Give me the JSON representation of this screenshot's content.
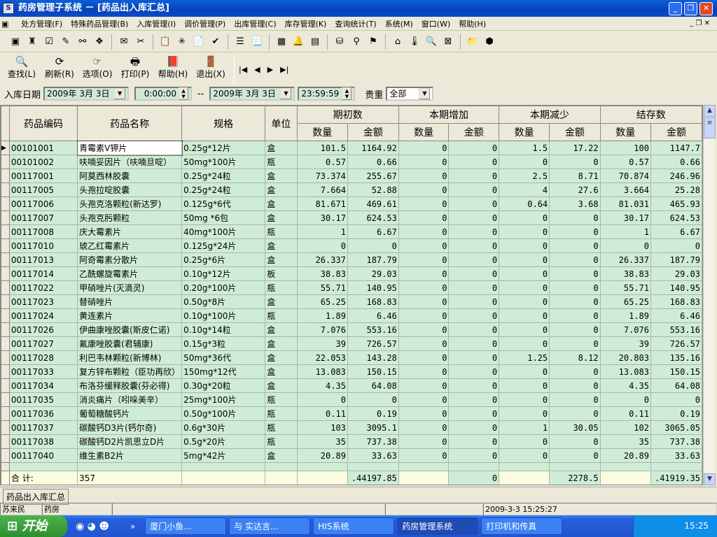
{
  "window": {
    "title": "药房管理子系统 － [药品出入库汇总]"
  },
  "menu": [
    "处方管理(F)",
    "特殊药品管理(B)",
    "入库管理(I)",
    "调价管理(P)",
    "出库管理(C)",
    "库存管理(K)",
    "查询统计(T)",
    "系统(M)",
    "窗口(W)",
    "帮助(H)"
  ],
  "toolbar2": [
    {
      "icon": "search-icon",
      "glyph": "🔍",
      "label": "查找(L)"
    },
    {
      "icon": "refresh-icon",
      "glyph": "⟳",
      "label": "刷新(R)"
    },
    {
      "icon": "options-icon",
      "glyph": "☞",
      "label": "选项(O)"
    },
    {
      "icon": "printer-icon",
      "glyph": "🖶",
      "label": "打印(P)"
    },
    {
      "icon": "help-book-icon",
      "glyph": "📕",
      "label": "帮助(H)"
    },
    {
      "icon": "exit-door-icon",
      "glyph": "🚪",
      "label": "退出(X)"
    }
  ],
  "nav": [
    "|◀",
    "◀",
    "▶",
    "▶|"
  ],
  "filters": {
    "label": "入库日期",
    "date_from": "2009年  3月  3日",
    "time_from": "0:00:00",
    "dash": "--",
    "date_to": "2009年  3月  3日",
    "time_to": "23:59:59",
    "price_label": "贵重",
    "price_value": "全部"
  },
  "grid": {
    "headers": {
      "code": "药品编码",
      "name": "药品名称",
      "spec": "规格",
      "unit": "单位",
      "groups": [
        "期初数",
        "本期增加",
        "本期减少",
        "结存数"
      ],
      "qty": "数量",
      "amt": "金额"
    },
    "rows": [
      [
        "00101001",
        "青霉素V钾片",
        "0.25g*12片",
        "盒",
        "101.5",
        "1164.92",
        "0",
        "0",
        "1.5",
        "17.22",
        "100",
        "1147.7"
      ],
      [
        "00101002",
        "呋喃妥因片（呋喃旦啶）",
        "50mg*100片",
        "瓶",
        "0.57",
        "0.66",
        "0",
        "0",
        "0",
        "0",
        "0.57",
        "0.66"
      ],
      [
        "00117001",
        "阿莫西林胶囊",
        "0.25g*24粒",
        "盒",
        "73.374",
        "255.67",
        "0",
        "0",
        "2.5",
        "8.71",
        "70.874",
        "246.96"
      ],
      [
        "00117005",
        "头孢拉啶胶囊",
        "0.25g*24粒",
        "盒",
        "7.664",
        "52.88",
        "0",
        "0",
        "4",
        "27.6",
        "3.664",
        "25.28"
      ],
      [
        "00117006",
        "头孢克洛颗粒(新达罗)",
        "0.125g*6代",
        "盒",
        "81.671",
        "469.61",
        "0",
        "0",
        "0.64",
        "3.68",
        "81.031",
        "465.93"
      ],
      [
        "00117007",
        "头孢克肟颗粒",
        "50mg *6包",
        "盒",
        "30.17",
        "624.53",
        "0",
        "0",
        "0",
        "0",
        "30.17",
        "624.53"
      ],
      [
        "00117008",
        "庆大霉素片",
        "40mg*100片",
        "瓶",
        "1",
        "6.67",
        "0",
        "0",
        "0",
        "0",
        "1",
        "6.67"
      ],
      [
        "00117010",
        "琥乙红霉素片",
        "0.125g*24片",
        "盒",
        "0",
        "0",
        "0",
        "0",
        "0",
        "0",
        "0",
        "0"
      ],
      [
        "00117013",
        "阿奇霉素分散片",
        "0.25g*6片",
        "盒",
        "26.337",
        "187.79",
        "0",
        "0",
        "0",
        "0",
        "26.337",
        "187.79"
      ],
      [
        "00117014",
        "乙酰螺旋霉素片",
        "0.10g*12片",
        "板",
        "38.83",
        "29.03",
        "0",
        "0",
        "0",
        "0",
        "38.83",
        "29.03"
      ],
      [
        "00117022",
        "甲硝唑片(灭滴灵)",
        "0.20g*100片",
        "瓶",
        "55.71",
        "140.95",
        "0",
        "0",
        "0",
        "0",
        "55.71",
        "140.95"
      ],
      [
        "00117023",
        "替硝唑片",
        "0.50g*8片",
        "盒",
        "65.25",
        "168.83",
        "0",
        "0",
        "0",
        "0",
        "65.25",
        "168.83"
      ],
      [
        "00117024",
        "黄连素片",
        "0.10g*100片",
        "瓶",
        "1.89",
        "6.46",
        "0",
        "0",
        "0",
        "0",
        "1.89",
        "6.46"
      ],
      [
        "00117026",
        "伊曲康唑胶囊(斯皮仁诺)",
        "0.10g*14粒",
        "盒",
        "7.076",
        "553.16",
        "0",
        "0",
        "0",
        "0",
        "7.076",
        "553.16"
      ],
      [
        "00117027",
        "氟康唑胶囊(君辅康)",
        "0.15g*3粒",
        "盒",
        "39",
        "726.57",
        "0",
        "0",
        "0",
        "0",
        "39",
        "726.57"
      ],
      [
        "00117028",
        "利巴韦林颗粒(新博林)",
        "50mg*36代",
        "盒",
        "22.053",
        "143.28",
        "0",
        "0",
        "1.25",
        "8.12",
        "20.803",
        "135.16"
      ],
      [
        "00117033",
        "复方锌布颗粒（臣功再欣）",
        "150mg*12代",
        "盒",
        "13.083",
        "150.15",
        "0",
        "0",
        "0",
        "0",
        "13.083",
        "150.15"
      ],
      [
        "00117034",
        "布洛芬缓释胶囊(芬必得)",
        "0.30g*20粒",
        "盒",
        "4.35",
        "64.08",
        "0",
        "0",
        "0",
        "0",
        "4.35",
        "64.08"
      ],
      [
        "00117035",
        "消炎痛片（吲哚美辛）",
        "25mg*100片",
        "瓶",
        "0",
        "0",
        "0",
        "0",
        "0",
        "0",
        "0",
        "0"
      ],
      [
        "00117036",
        "葡萄糖酸钙片",
        "0.50g*100片",
        "瓶",
        "0.11",
        "0.19",
        "0",
        "0",
        "0",
        "0",
        "0.11",
        "0.19"
      ],
      [
        "00117037",
        "碳酸钙D3片(钙尔奇)",
        "0.6g*30片",
        "瓶",
        "103",
        "3095.1",
        "0",
        "0",
        "1",
        "30.05",
        "102",
        "3065.05"
      ],
      [
        "00117038",
        "碳酸钙D2片凯思立D片",
        "0.5g*20片",
        "瓶",
        "35",
        "737.38",
        "0",
        "0",
        "0",
        "0",
        "35",
        "737.38"
      ],
      [
        "00117040",
        "维生素B2片",
        "5mg*42片",
        "盒",
        "20.89",
        "33.63",
        "0",
        "0",
        "0",
        "0",
        "20.89",
        "33.63"
      ]
    ],
    "totals": {
      "label": "合    计:",
      "count": "357",
      "begin_amt": ".44197.85",
      "add_amt": "0",
      "sub_amt": "2278.5",
      "end_amt": ".41919.35"
    }
  },
  "tab": "药品出入库汇总",
  "status": {
    "user": "苏来民",
    "dept": "药房",
    "datetime": "2009-3-3 15:25:27"
  },
  "taskbar": {
    "start": "开始",
    "tasks": [
      "厦门小鱼...",
      "与 实达言...",
      "HIS系统",
      "药房管理系统",
      "打印机和传真"
    ],
    "clock": "15:25"
  }
}
